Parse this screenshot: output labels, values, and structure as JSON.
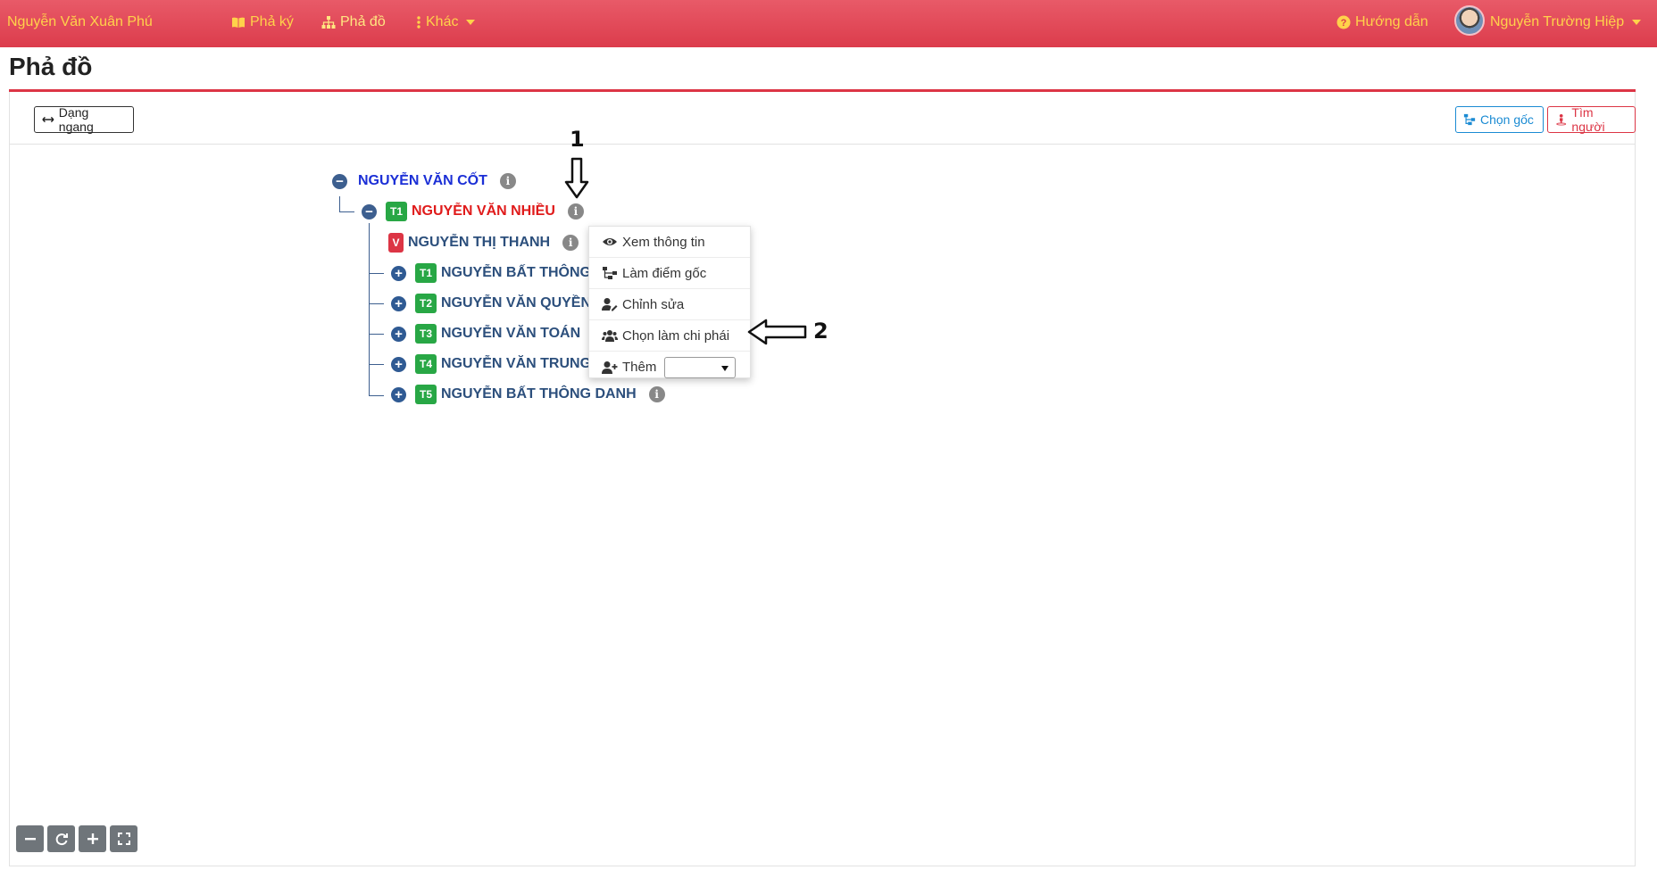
{
  "navbar": {
    "brand": "Nguyễn Văn Xuân Phú",
    "links": [
      {
        "label": "Phả ký",
        "icon": "book-icon"
      },
      {
        "label": "Phả đồ",
        "icon": "sitemap-icon"
      },
      {
        "label": "Khác",
        "icon": "vertical-dots-icon"
      }
    ],
    "help": "Hướng dẫn",
    "user": "Nguyễn Trường Hiệp"
  },
  "page": {
    "title": "Phả đồ"
  },
  "toolbar": {
    "layout_button": "Dạng ngang",
    "root_button": "Chọn gốc",
    "find_button": "Tìm người"
  },
  "tree": {
    "root": {
      "name": "NGUYỄN VĂN CỐT"
    },
    "child": {
      "badge": "T1",
      "name": "NGUYỄN VĂN NHIỀU"
    },
    "spouse": {
      "badge": "V",
      "name": "NGUYỄN THỊ THANH"
    },
    "children": [
      {
        "badge": "T1",
        "name": "NGUYỄN BẤT THÔNG"
      },
      {
        "badge": "T2",
        "name": "NGUYỄN VĂN QUYỀN"
      },
      {
        "badge": "T3",
        "name": "NGUYỄN VĂN TOÁN"
      },
      {
        "badge": "T4",
        "name": "NGUYỄN VĂN TRUNG"
      },
      {
        "badge": "T5",
        "name": "NGUYỄN BẤT THÔNG DANH"
      }
    ]
  },
  "context_menu": {
    "items": [
      "Xem thông tin",
      "Làm điểm gốc",
      "Chỉnh sửa",
      "Chọn làm chi phái",
      "Thêm"
    ]
  },
  "annotations": {
    "one": "1",
    "two": "2"
  },
  "colors": {
    "navbar": "#dc3c4c",
    "nav_text": "#ffd24a",
    "accent_red": "#dc3545",
    "accent_blue": "#1b8bd3",
    "badge_green": "#28a745"
  }
}
